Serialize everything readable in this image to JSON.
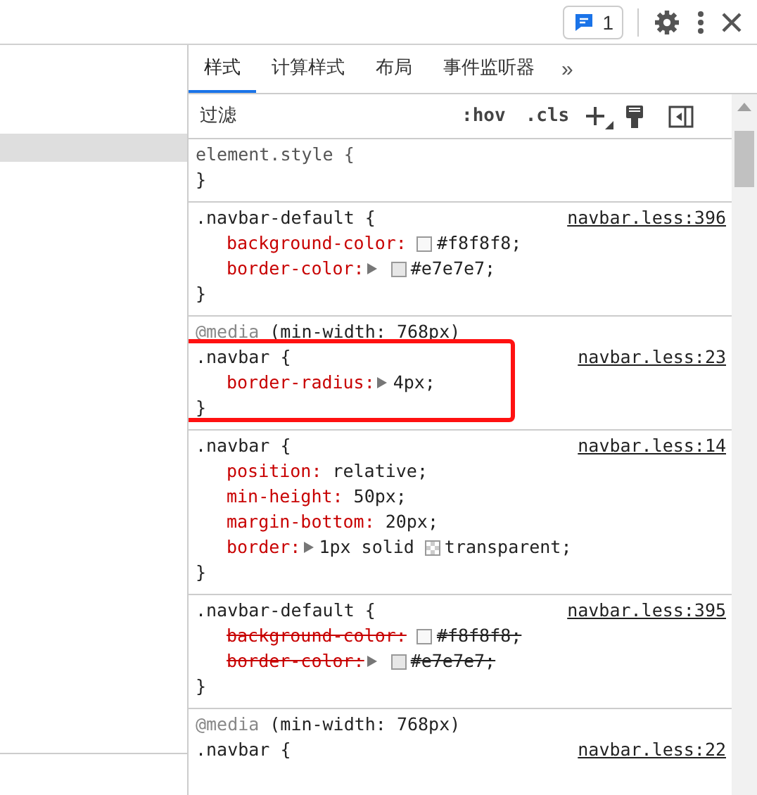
{
  "top_bar": {
    "issues_count": "1"
  },
  "tabs": [
    {
      "label": "样式",
      "selected": true
    },
    {
      "label": "计算样式",
      "selected": false
    },
    {
      "label": "布局",
      "selected": false
    },
    {
      "label": "事件监听器",
      "selected": false
    }
  ],
  "tabs_overflow": "»",
  "filter": {
    "placeholder": "过滤",
    "buttons": [
      ":hov",
      ".cls"
    ]
  },
  "rules": [
    {
      "selector": "element.style {",
      "close": "}",
      "inline": true,
      "highlighted": false
    },
    {
      "selector": ".navbar-default {",
      "source": "navbar.less:396",
      "close": "}",
      "inline": false,
      "highlighted": false,
      "properties": [
        {
          "name": "background-color:",
          "expandable": false,
          "swatch": true,
          "color": "#f8f8f8",
          "value": "#f8f8f8;",
          "overridden": false
        },
        {
          "name": "border-color:",
          "expandable": true,
          "swatch": true,
          "color": "#e7e7e7",
          "value": "#e7e7e7;",
          "overridden": false
        }
      ]
    },
    {
      "media": "@media",
      "media_query": "(min-width: 768px)",
      "selector": ".navbar {",
      "source": "navbar.less:23",
      "close": "}",
      "inline": false,
      "highlighted": true,
      "properties": [
        {
          "name": "border-radius:",
          "expandable": true,
          "swatch": false,
          "value": "4px;",
          "overridden": false
        }
      ]
    },
    {
      "selector": ".navbar {",
      "source": "navbar.less:14",
      "close": "}",
      "inline": false,
      "highlighted": false,
      "properties": [
        {
          "name": "position:",
          "expandable": false,
          "swatch": false,
          "value": "relative;",
          "overridden": false
        },
        {
          "name": "min-height:",
          "expandable": false,
          "swatch": false,
          "value": "50px;",
          "overridden": false
        },
        {
          "name": "margin-bottom:",
          "expandable": false,
          "swatch": false,
          "value": "20px;",
          "overridden": false
        },
        {
          "name": "border:",
          "expandable": true,
          "prefix": "1px solid",
          "swatch": true,
          "value": "transparent;",
          "overridden": false
        }
      ]
    },
    {
      "selector": ".navbar-default {",
      "source": "navbar.less:395",
      "close": "}",
      "inline": false,
      "highlighted": false,
      "properties": [
        {
          "name": "background-color:",
          "expandable": false,
          "swatch": true,
          "color": "#f8f8f8",
          "value": "#f8f8f8;",
          "overridden": true
        },
        {
          "name": "border-color:",
          "expandable": true,
          "swatch": true,
          "color": "#e7e7e7",
          "value": "#e7e7e7;",
          "overridden": true
        }
      ]
    },
    {
      "media": "@media",
      "media_query": "(min-width: 768px)",
      "selector": ".navbar {",
      "source": "navbar.less:22",
      "inline": false,
      "highlighted": false
    }
  ]
}
